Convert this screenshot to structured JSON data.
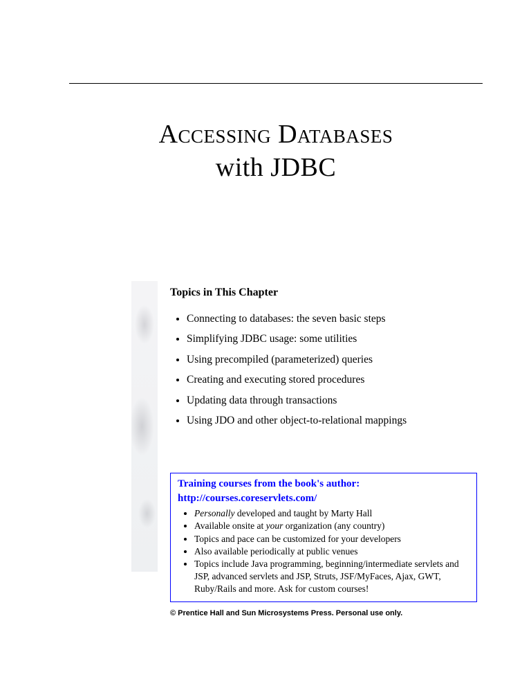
{
  "title": {
    "line1": "Accessing Databases",
    "line2": "with JDBC"
  },
  "topics": {
    "heading": "Topics in This Chapter",
    "items": [
      "Connecting to databases: the seven basic steps",
      "Simplifying JDBC usage: some utilities",
      "Using precompiled (parameterized) queries",
      "Creating and executing stored procedures",
      "Updating data through transactions",
      "Using JDO and other object-to-relational mappings"
    ]
  },
  "promo": {
    "title": "Training courses from the book's author:",
    "link_text": "http://courses.coreservlets.com/",
    "bullets": [
      "<em>Personally</em> developed and taught by Marty Hall",
      "Available onsite at <em>your</em> organization (any country)",
      "Topics and pace can be customized for your developers",
      "Also available periodically at public venues",
      "Topics include Java programming, beginning/intermediate servlets and JSP, advanced servlets and JSP, Struts, JSF/MyFaces, Ajax, GWT, Ruby/Rails and more. Ask for custom courses!"
    ]
  },
  "copyright": "© Prentice Hall and Sun Microsystems Press. Personal use only."
}
